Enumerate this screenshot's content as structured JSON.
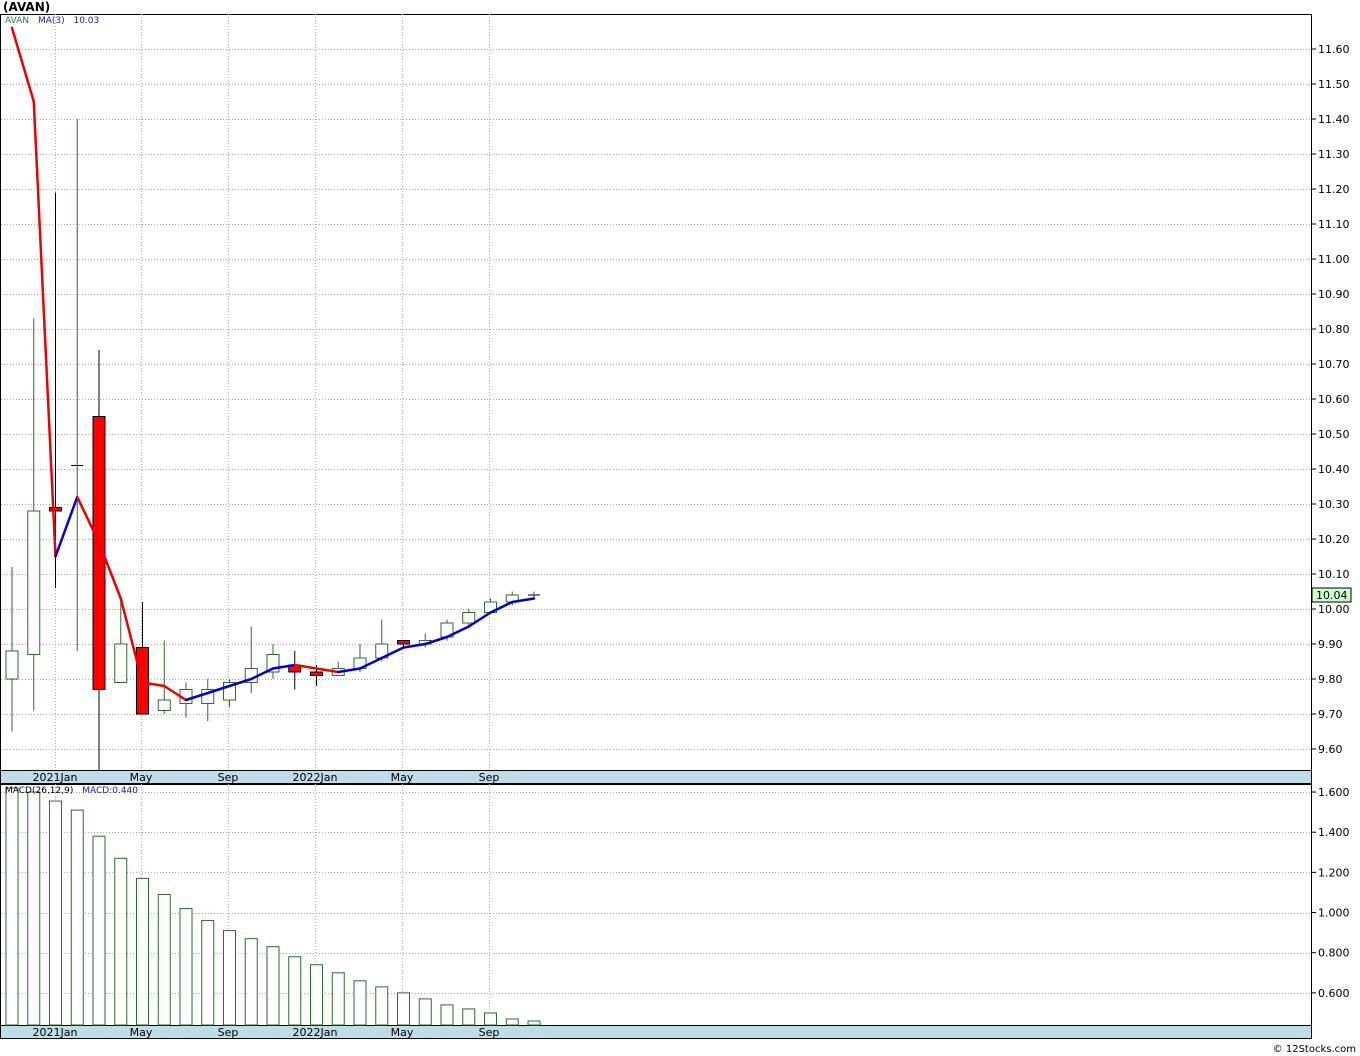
{
  "ticker_title": "(AVAN)",
  "price_legend": {
    "symbol": "AVAN",
    "ma_label": "MA(3)",
    "ma_value": "10.03"
  },
  "macd_legend": {
    "label": "MACD(26,12,9)",
    "value_label": "MACD:0.440"
  },
  "last_price_tag": "10.04",
  "credit": "© 12Stocks.com",
  "colors": {
    "up": "#2e6b2e",
    "down": "#ff0000",
    "ma_up": "#0000dd",
    "ma_down": "#ee0000",
    "axis_band": "#bfdde6",
    "last_tag_bg": "#ccffcc"
  },
  "chart_data": [
    {
      "type": "candlestick",
      "title": "(AVAN)",
      "x_ticks": [
        "2021Jan",
        "May",
        "Sep",
        "2022Jan",
        "May",
        "Sep"
      ],
      "ylim": [
        9.54,
        11.7
      ],
      "y_ticks": [
        "9.60",
        "9.70",
        "9.80",
        "9.90",
        "10.00",
        "10.10",
        "10.20",
        "10.30",
        "10.40",
        "10.50",
        "10.60",
        "10.70",
        "10.80",
        "10.90",
        "11.00",
        "11.10",
        "11.20",
        "11.30",
        "11.40",
        "11.50",
        "11.60"
      ],
      "grid": true,
      "candles": [
        {
          "o": 9.8,
          "h": 10.12,
          "l": 9.65,
          "c": 9.88
        },
        {
          "o": 9.87,
          "h": 10.83,
          "l": 9.71,
          "c": 10.28
        },
        {
          "o": 10.29,
          "h": 11.19,
          "l": 10.06,
          "c": 10.28
        },
        {
          "o": 10.41,
          "h": 11.4,
          "l": 9.88,
          "c": 10.41
        },
        {
          "o": 10.55,
          "h": 10.74,
          "l": 9.54,
          "c": 9.77
        },
        {
          "o": 9.79,
          "h": 10.02,
          "l": 9.79,
          "c": 9.9
        },
        {
          "o": 9.89,
          "h": 10.02,
          "l": 9.7,
          "c": 9.7
        },
        {
          "o": 9.71,
          "h": 9.91,
          "l": 9.7,
          "c": 9.74
        },
        {
          "o": 9.73,
          "h": 9.79,
          "l": 9.69,
          "c": 9.77
        },
        {
          "o": 9.73,
          "h": 9.8,
          "l": 9.68,
          "c": 9.77
        },
        {
          "o": 9.74,
          "h": 9.8,
          "l": 9.72,
          "c": 9.79
        },
        {
          "o": 9.79,
          "h": 9.95,
          "l": 9.76,
          "c": 9.83
        },
        {
          "o": 9.82,
          "h": 9.9,
          "l": 9.8,
          "c": 9.87
        },
        {
          "o": 9.84,
          "h": 9.88,
          "l": 9.77,
          "c": 9.82
        },
        {
          "o": 9.82,
          "h": 9.84,
          "l": 9.78,
          "c": 9.81
        },
        {
          "o": 9.81,
          "h": 9.85,
          "l": 9.81,
          "c": 9.83
        },
        {
          "o": 9.83,
          "h": 9.9,
          "l": 9.82,
          "c": 9.86
        },
        {
          "o": 9.86,
          "h": 9.97,
          "l": 9.85,
          "c": 9.9
        },
        {
          "o": 9.91,
          "h": 9.91,
          "l": 9.89,
          "c": 9.9
        },
        {
          "o": 9.9,
          "h": 9.93,
          "l": 9.89,
          "c": 9.91
        },
        {
          "o": 9.92,
          "h": 9.97,
          "l": 9.91,
          "c": 9.96
        },
        {
          "o": 9.96,
          "h": 10.0,
          "l": 9.95,
          "c": 9.99
        },
        {
          "o": 9.99,
          "h": 10.03,
          "l": 9.99,
          "c": 10.02
        },
        {
          "o": 10.02,
          "h": 10.05,
          "l": 10.01,
          "c": 10.04
        },
        {
          "o": 10.04,
          "h": 10.05,
          "l": 10.03,
          "c": 10.04
        }
      ],
      "ma": [
        11.66,
        11.45,
        10.15,
        10.32,
        10.19,
        10.03,
        9.79,
        9.78,
        9.74,
        9.76,
        9.78,
        9.8,
        9.83,
        9.84,
        9.83,
        9.82,
        9.83,
        9.86,
        9.89,
        9.9,
        9.92,
        9.95,
        9.99,
        10.02,
        10.03
      ]
    },
    {
      "type": "bar",
      "title": "MACD(26,12,9)",
      "x_ticks": [
        "2021Jan",
        "May",
        "Sep",
        "2022Jan",
        "May",
        "Sep"
      ],
      "ylim": [
        0.44,
        1.64
      ],
      "y_ticks": [
        "0.600",
        "0.800",
        "1.000",
        "1.200",
        "1.400",
        "1.600"
      ],
      "values": [
        1.62,
        1.6,
        1.555,
        1.51,
        1.38,
        1.27,
        1.17,
        1.09,
        1.02,
        0.96,
        0.91,
        0.87,
        0.83,
        0.78,
        0.74,
        0.7,
        0.66,
        0.63,
        0.6,
        0.57,
        0.54,
        0.52,
        0.5,
        0.47,
        0.46
      ]
    }
  ]
}
